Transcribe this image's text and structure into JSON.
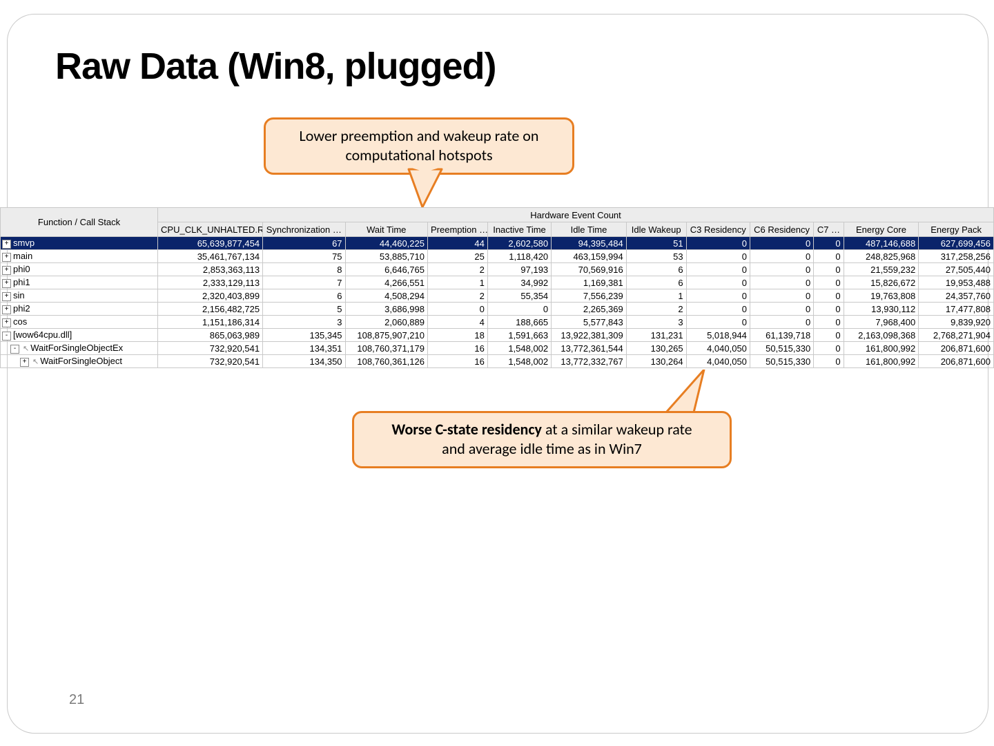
{
  "slide": {
    "title": "Raw Data (Win8, plugged)",
    "page_number": "21"
  },
  "callouts": {
    "top_line1": "Lower preemption and wakeup rate on",
    "top_line2": "computational hotspots",
    "bottom_strong": "Worse C-state residency",
    "bottom_rest1": " at a similar wakeup rate",
    "bottom_line2": "and average idle time as in Win7"
  },
  "table": {
    "header_rowspan": "Function / Call Stack",
    "group_header": "Hardware Event Count",
    "columns": [
      "CPU_CLK_UNHALTED.REF …",
      "Synchronization …",
      "Wait Time",
      "Preemption …",
      "Inactive Time",
      "Idle Time",
      "Idle Wakeup",
      "C3 Residency",
      "C6 Residency",
      "C7 …",
      "Energy Core",
      "Energy Pack"
    ],
    "rows": [
      {
        "sel": true,
        "indent": 0,
        "icon": "+",
        "name": "smvp",
        "v": [
          "65,639,877,454",
          "67",
          "44,460,225",
          "44",
          "2,602,580",
          "94,395,484",
          "51",
          "0",
          "0",
          "0",
          "487,146,688",
          "627,699,456"
        ]
      },
      {
        "sel": false,
        "indent": 0,
        "icon": "+",
        "name": "main",
        "v": [
          "35,461,767,134",
          "75",
          "53,885,710",
          "25",
          "1,118,420",
          "463,159,994",
          "53",
          "0",
          "0",
          "0",
          "248,825,968",
          "317,258,256"
        ]
      },
      {
        "sel": false,
        "indent": 0,
        "icon": "+",
        "name": "phi0",
        "v": [
          "2,853,363,113",
          "8",
          "6,646,765",
          "2",
          "97,193",
          "70,569,916",
          "6",
          "0",
          "0",
          "0",
          "21,559,232",
          "27,505,440"
        ]
      },
      {
        "sel": false,
        "indent": 0,
        "icon": "+",
        "name": "phi1",
        "v": [
          "2,333,129,113",
          "7",
          "4,266,551",
          "1",
          "34,992",
          "1,169,381",
          "6",
          "0",
          "0",
          "0",
          "15,826,672",
          "19,953,488"
        ]
      },
      {
        "sel": false,
        "indent": 0,
        "icon": "+",
        "name": "sin",
        "v": [
          "2,320,403,899",
          "6",
          "4,508,294",
          "2",
          "55,354",
          "7,556,239",
          "1",
          "0",
          "0",
          "0",
          "19,763,808",
          "24,357,760"
        ]
      },
      {
        "sel": false,
        "indent": 0,
        "icon": "+",
        "name": "phi2",
        "v": [
          "2,156,482,725",
          "5",
          "3,686,998",
          "0",
          "0",
          "2,265,369",
          "2",
          "0",
          "0",
          "0",
          "13,930,112",
          "17,477,808"
        ]
      },
      {
        "sel": false,
        "indent": 0,
        "icon": "+",
        "name": "cos",
        "v": [
          "1,151,186,314",
          "3",
          "2,060,889",
          "4",
          "188,665",
          "5,577,843",
          "3",
          "0",
          "0",
          "0",
          "7,968,400",
          "9,839,920"
        ]
      },
      {
        "sel": false,
        "indent": 0,
        "icon": "-",
        "name": "[wow64cpu.dll]",
        "v": [
          "865,063,989",
          "135,345",
          "108,875,907,210",
          "18",
          "1,591,663",
          "13,922,381,309",
          "131,231",
          "5,018,944",
          "61,139,718",
          "0",
          "2,163,098,368",
          "2,768,271,904"
        ]
      },
      {
        "sel": false,
        "indent": 1,
        "icon": "-",
        "arrow": true,
        "name": "WaitForSingleObjectEx",
        "v": [
          "732,920,541",
          "134,351",
          "108,760,371,179",
          "16",
          "1,548,002",
          "13,772,361,544",
          "130,265",
          "4,040,050",
          "50,515,330",
          "0",
          "161,800,992",
          "206,871,600"
        ]
      },
      {
        "sel": false,
        "indent": 2,
        "icon": "+",
        "arrow": true,
        "name": "WaitForSingleObject",
        "v": [
          "732,920,541",
          "134,350",
          "108,760,361,126",
          "16",
          "1,548,002",
          "13,772,332,767",
          "130,264",
          "4,040,050",
          "50,515,330",
          "0",
          "161,800,992",
          "206,871,600"
        ]
      }
    ]
  }
}
